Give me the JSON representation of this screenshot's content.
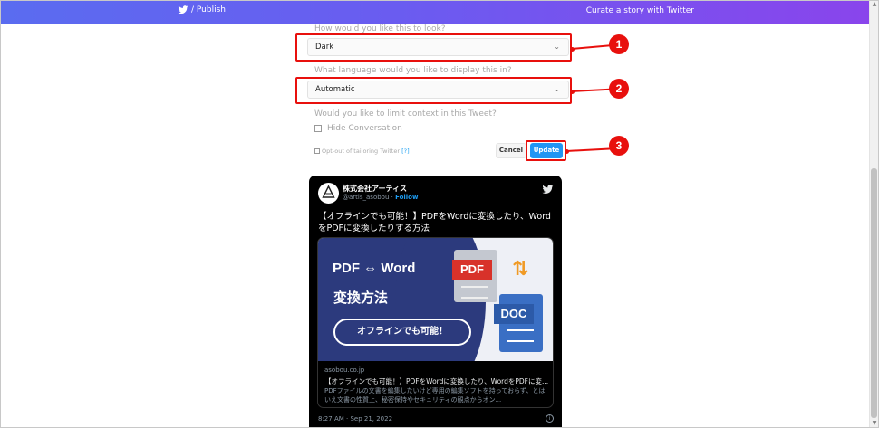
{
  "header": {
    "brand_label": "/ Publish",
    "curate_label": "Curate a story with Twitter"
  },
  "form": {
    "look_question": "How would you like this to look?",
    "theme_value": "Dark",
    "language_question": "What language would you like to display this in?",
    "language_value": "Automatic",
    "context_question": "Would you like to limit context in this Tweet?",
    "hide_conversation_label": "Hide Conversation",
    "optout_label": "Opt-out of tailoring Twitter",
    "optout_help": "[?]",
    "cancel_label": "Cancel",
    "update_label": "Update"
  },
  "annotations": {
    "badge_1": "1",
    "badge_2": "2",
    "badge_3": "3",
    "color": "#e8100d"
  },
  "tweet": {
    "account_name": "株式会社アーティス",
    "handle": "@artis_asobou",
    "follow_label": "Follow",
    "text": "【オフラインでも可能！】PDFをWordに変換したり、WordをPDFに変換したりする方法",
    "card": {
      "image_pdf_word": "PDF ⇔ Word",
      "image_henkan": "変換方法",
      "image_offline": "オフラインでも可能！",
      "image_pdf_label": "PDF",
      "image_doc_label": "DOC",
      "domain": "asobou.co.jp",
      "title": "【オフラインでも可能！】PDFをWordに変換したり、WordをPDFに変...",
      "description": "PDFファイルの文書を編集したいけど専用の編集ソフトを持っておらず、とはいえ文書の性質上、秘密保持やセキュリティの観点からオン..."
    },
    "timestamp": "8:27 AM · Sep 21, 2022"
  },
  "colors": {
    "header_gradient_start": "#5a6cf0",
    "header_gradient_end": "#8a44ec",
    "update_button": "#2195f3",
    "follow_link": "#1d9bf0"
  }
}
